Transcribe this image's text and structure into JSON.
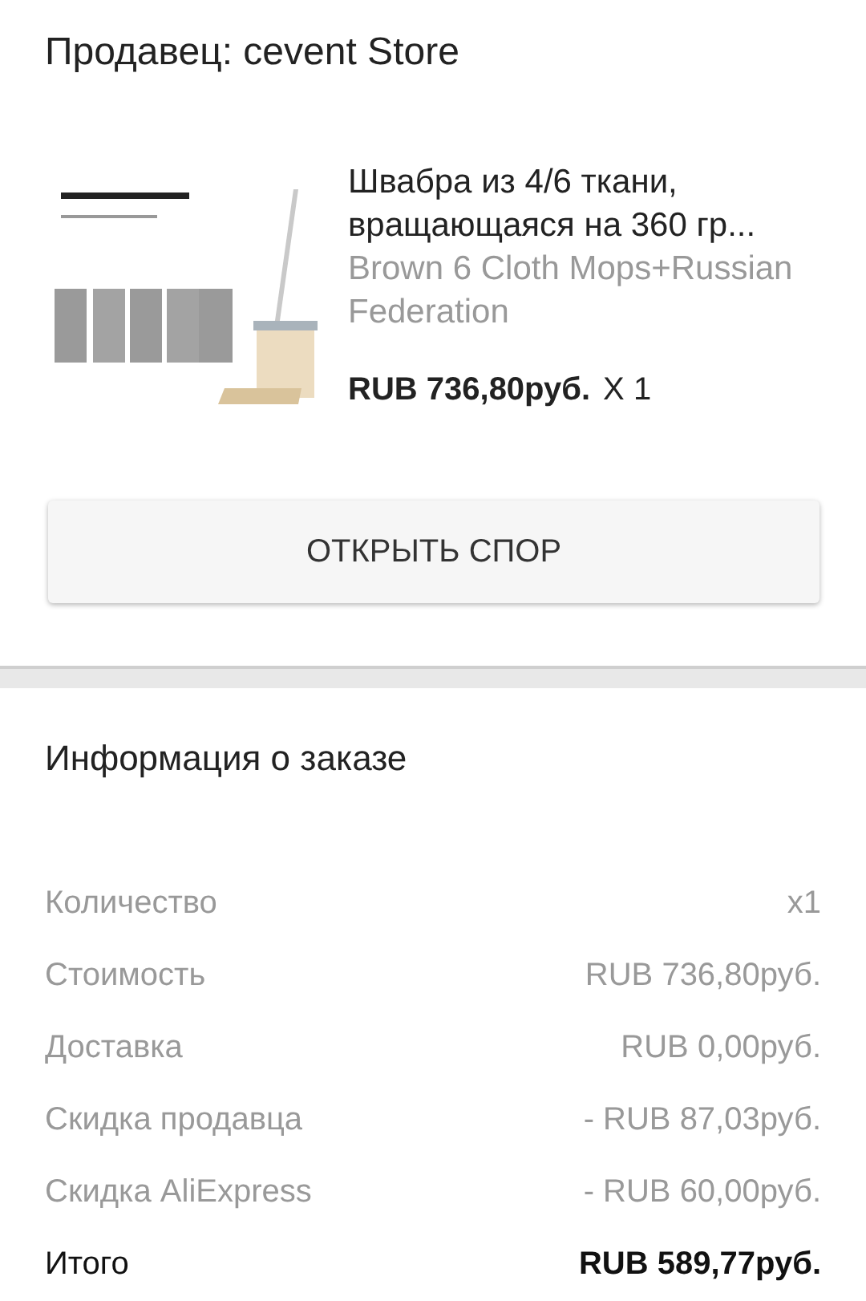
{
  "seller": {
    "label": "Продавец: cevent Store"
  },
  "product": {
    "title": "Швабра из 4/6 ткани, вращающаяся на 360 гр...",
    "variant": "Brown 6 Cloth Mops+Russian Federation",
    "price": "RUB 736,80руб.",
    "quantity": "X 1"
  },
  "dispute_button": "ОТКРЫТЬ СПОР",
  "order_info": {
    "title": "Информация о заказе",
    "rows": [
      {
        "kind": "normal",
        "label": "Количество",
        "value": "x1"
      },
      {
        "kind": "normal",
        "label": "Стоимость",
        "value": "RUB 736,80руб."
      },
      {
        "kind": "normal",
        "label": "Доставка",
        "value": "RUB 0,00руб."
      },
      {
        "kind": "normal",
        "label": "Скидка продавца",
        "value": "- RUB 87,03руб."
      },
      {
        "kind": "normal",
        "label": "Скидка AliExpress",
        "value": "- RUB 60,00руб."
      },
      {
        "kind": "total",
        "label": "Итого",
        "value": "RUB 589,77руб."
      }
    ]
  }
}
